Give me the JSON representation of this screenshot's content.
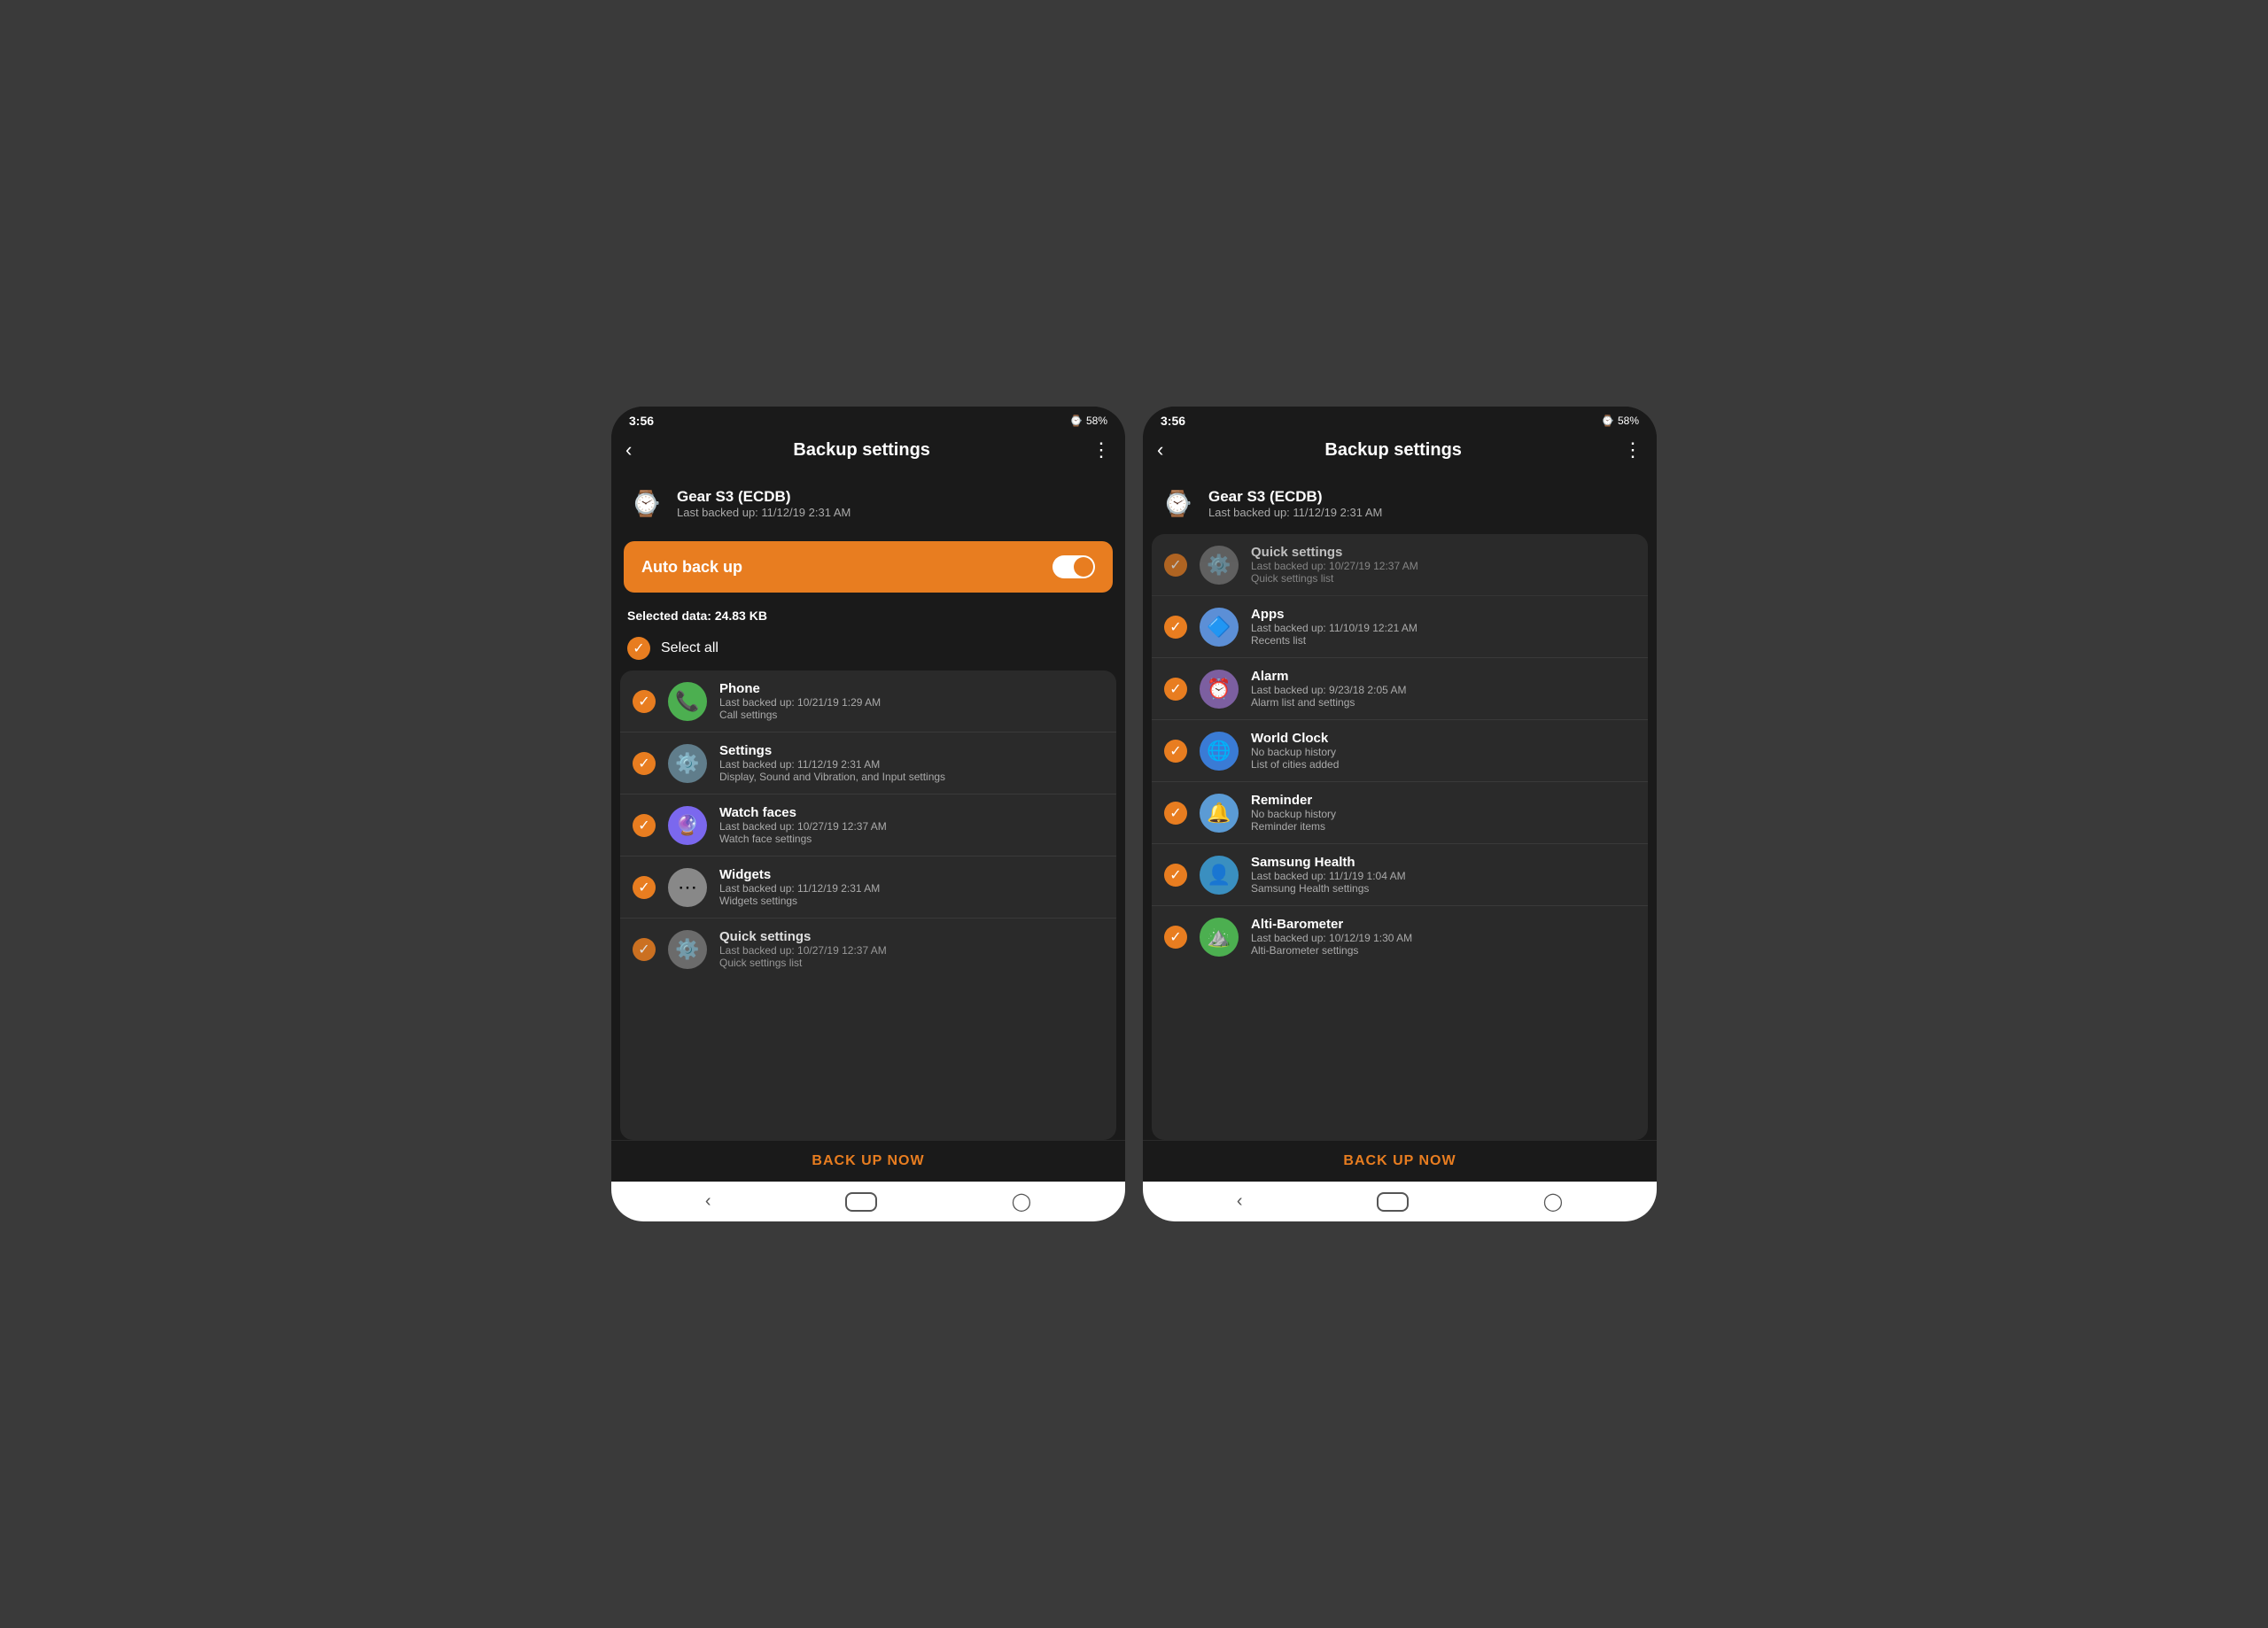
{
  "screen1": {
    "status": {
      "time": "3:56",
      "battery": "58%"
    },
    "title": "Backup settings",
    "device": {
      "name": "Gear S3 (ECDB)",
      "lastBackedUp": "Last backed up: 11/12/19 2:31 AM"
    },
    "autoBackup": {
      "label": "Auto back up",
      "enabled": true
    },
    "selectedData": "Selected data: 24.83 KB",
    "selectAll": "Select all",
    "items": [
      {
        "name": "Phone",
        "icon": "📞",
        "iconBg": "#4CAF50",
        "lastBackedUp": "Last backed up: 10/21/19 1:29 AM",
        "desc": "Call settings",
        "checked": true
      },
      {
        "name": "Settings",
        "icon": "⚙️",
        "iconBg": "#607D8B",
        "lastBackedUp": "Last backed up: 11/12/19 2:31 AM",
        "desc": "Display, Sound and Vibration, and Input settings",
        "checked": true
      },
      {
        "name": "Watch faces",
        "icon": "🔮",
        "iconBg": "#7B68EE",
        "lastBackedUp": "Last backed up: 10/27/19 12:37 AM",
        "desc": "Watch face settings",
        "checked": true
      },
      {
        "name": "Widgets",
        "icon": "⋯",
        "iconBg": "#888",
        "lastBackedUp": "Last backed up: 11/12/19 2:31 AM",
        "desc": "Widgets settings",
        "checked": true
      },
      {
        "name": "Quick settings",
        "icon": "⚙️",
        "iconBg": "#777",
        "lastBackedUp": "Last backed up: 10/27/19 12:37 AM",
        "desc": "Quick settings list",
        "checked": true
      }
    ],
    "backUpNow": "BACK UP NOW"
  },
  "screen2": {
    "status": {
      "time": "3:56",
      "battery": "58%"
    },
    "title": "Backup settings",
    "device": {
      "name": "Gear S3 (ECDB)",
      "lastBackedUp": "Last backed up: 11/12/19 2:31 AM"
    },
    "items": [
      {
        "name": "Quick settings",
        "icon": "⚙️",
        "iconBg": "#777",
        "lastBackedUp": "Last backed up: 10/27/19 12:37 AM",
        "desc": "Quick settings list",
        "checked": true
      },
      {
        "name": "Apps",
        "icon": "🔷",
        "iconBg": "#5C8FD6",
        "lastBackedUp": "Last backed up: 11/10/19 12:21 AM",
        "desc": "Recents list",
        "checked": true
      },
      {
        "name": "Alarm",
        "icon": "⏰",
        "iconBg": "#7C5FA0",
        "lastBackedUp": "Last backed up: 9/23/18 2:05 AM",
        "desc": "Alarm list and settings",
        "checked": true
      },
      {
        "name": "World Clock",
        "icon": "🌐",
        "iconBg": "#3A7BD5",
        "lastBackedUp": "No backup history",
        "desc": "List of cities added",
        "checked": true
      },
      {
        "name": "Reminder",
        "icon": "🔔",
        "iconBg": "#5B9BD5",
        "lastBackedUp": "No backup history",
        "desc": "Reminder items",
        "checked": true
      },
      {
        "name": "Samsung Health",
        "icon": "👤",
        "iconBg": "#3A8FC0",
        "lastBackedUp": "Last backed up: 11/1/19 1:04 AM",
        "desc": "Samsung Health settings",
        "checked": true
      },
      {
        "name": "Alti-Barometer",
        "icon": "⛰️",
        "iconBg": "#4CAF50",
        "lastBackedUp": "Last backed up: 10/12/19 1:30 AM",
        "desc": "Alti-Barometer settings",
        "checked": true
      }
    ],
    "backUpNow": "BACK UP NOW"
  }
}
